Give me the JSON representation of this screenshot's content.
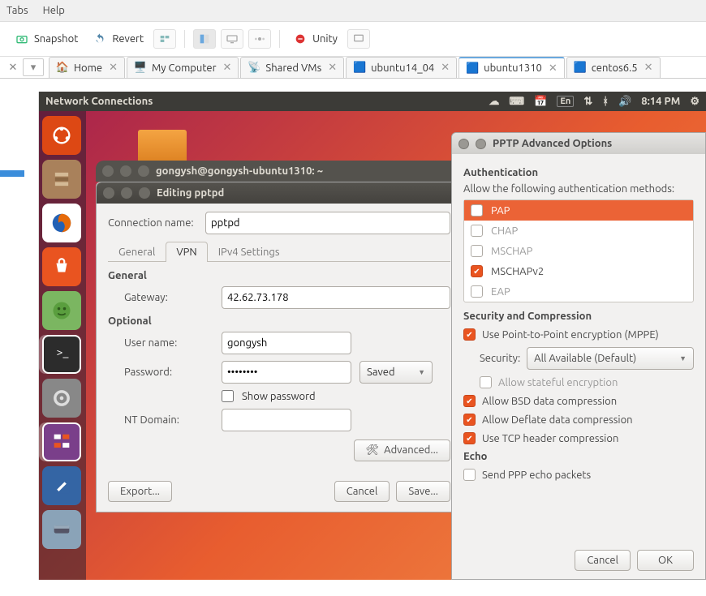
{
  "menubar": {
    "tabs": "Tabs",
    "help": "Help"
  },
  "toolbar": {
    "snapshot": "Snapshot",
    "revert": "Revert",
    "unity": "Unity"
  },
  "vmtabs": {
    "home": "Home",
    "mycomputer": "My Computer",
    "shared": "Shared VMs",
    "ubuntu14": "ubuntu14_04",
    "ubuntu1310": "ubuntu1310",
    "centos": "centos6.5"
  },
  "panel": {
    "title": "Network Connections",
    "lang": "En",
    "time": "8:14 PM"
  },
  "terminal": {
    "title": "gongysh@gongysh-ubuntu1310: ~"
  },
  "edit": {
    "title": "Editing pptpd",
    "conn_label": "Connection name:",
    "conn_value": "pptpd",
    "tab_general": "General",
    "tab_vpn": "VPN",
    "tab_ipv4": "IPv4 Settings",
    "section_general": "General",
    "gateway_label": "Gateway:",
    "gateway_value": "42.62.73.178",
    "section_optional": "Optional",
    "user_label": "User name:",
    "user_value": "gongysh",
    "pass_label": "Password:",
    "pass_value": "••••••••",
    "pass_option": "Saved",
    "show_password": "Show password",
    "nt_label": "NT Domain:",
    "nt_value": "",
    "advanced_btn": "Advanced...",
    "export_btn": "Export...",
    "cancel_btn": "Cancel",
    "save_btn": "Save..."
  },
  "adv": {
    "title": "PPTP Advanced Options",
    "auth_h": "Authentication",
    "auth_sub": "Allow the following authentication methods:",
    "auth_items": {
      "pap": "PAP",
      "chap": "CHAP",
      "mschap": "MSCHAP",
      "mschapv2": "MSCHAPv2",
      "eap": "EAP"
    },
    "sec_h": "Security and Compression",
    "mppe": "Use Point-to-Point encryption (MPPE)",
    "sec_label": "Security:",
    "sec_value": "All Available (Default)",
    "stateful": "Allow stateful encryption",
    "bsd": "Allow BSD data compression",
    "deflate": "Allow Deflate data compression",
    "tcp": "Use TCP header compression",
    "echo_h": "Echo",
    "echo_opt": "Send PPP echo packets",
    "cancel": "Cancel",
    "ok": "OK"
  }
}
